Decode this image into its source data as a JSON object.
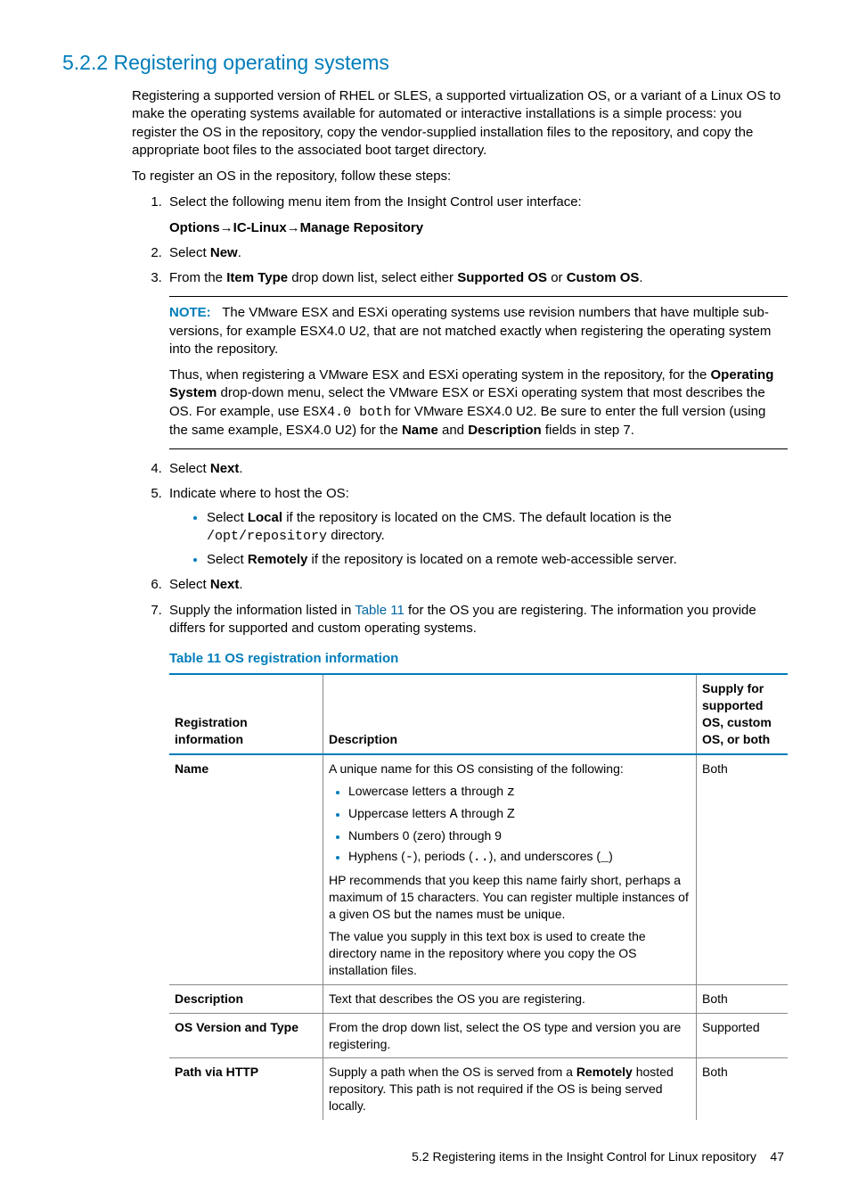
{
  "heading": "5.2.2 Registering operating systems",
  "intro_p1": "Registering a supported version of RHEL or SLES, a supported virtualization OS, or a variant of a Linux OS to make the operating systems available for automated or interactive installations is a simple process: you register the OS in the repository, copy the vendor-supplied installation files to the repository, and copy the appropriate boot files to the associated boot target directory.",
  "intro_p2": "To register an OS in the repository, follow these steps:",
  "step1_text": "Select the following menu item from the Insight Control user interface:",
  "menu_path_options": "Options",
  "menu_path_ic": "IC-Linux",
  "menu_path_manage": "Manage Repository",
  "step2_pre": "Select ",
  "step2_b": "New",
  "step2_post": ".",
  "step3_pre": "From the ",
  "step3_b1": "Item Type",
  "step3_mid": " drop down list, select either ",
  "step3_b2": "Supported OS",
  "step3_or": " or ",
  "step3_b3": "Custom OS",
  "step3_post": ".",
  "note_label": "NOTE:",
  "note_p1": "The VMware ESX and ESXi operating systems use revision numbers that have multiple sub-versions, for example ESX4.0 U2, that are not matched exactly when registering the operating system into the repository.",
  "note_p2_a": "Thus, when registering a VMware ESX and ESXi operating system in the repository, for the ",
  "note_p2_b1": "Operating System",
  "note_p2_b": " drop-down menu, select the VMware ESX or ESXi operating system that most describes the OS. For example, use ",
  "note_code": "ESX4.0 both",
  "note_p2_c": " for VMware ESX4.0 U2. Be sure to enter the full version (using the same example, ESX4.0 U2) for the ",
  "note_p2_b2": "Name",
  "note_p2_and": " and ",
  "note_p2_b3": "Description",
  "note_p2_d": " fields in step 7.",
  "step4_pre": "Select ",
  "step4_b": "Next",
  "step4_post": ".",
  "step5_text": "Indicate where to host the OS:",
  "step5_bullet1_pre": "Select ",
  "step5_bullet1_b": "Local",
  "step5_bullet1_mid": " if the repository is located on the CMS. The default location is the ",
  "step5_bullet1_code": "/opt/repository",
  "step5_bullet1_post": " directory.",
  "step5_bullet2_pre": "Select ",
  "step5_bullet2_b": "Remotely",
  "step5_bullet2_post": " if the repository is located on a remote web-accessible server.",
  "step6_pre": "Select ",
  "step6_b": "Next",
  "step6_post": ".",
  "step7_pre": "Supply the information listed in ",
  "step7_link": "Table 11",
  "step7_post": " for the OS you are registering. The information you provide differs for supported and custom operating systems.",
  "table_caption": "Table 11 OS registration information",
  "th1": "Registration information",
  "th2": "Description",
  "th3": "Supply for supported OS, custom OS, or both",
  "chart_data": {
    "type": "table",
    "columns": [
      "Registration information",
      "Description",
      "Supply for supported OS, custom OS, or both"
    ],
    "rows": [
      {
        "name": "Name",
        "desc_intro": "A unique name for this OS consisting of the following:",
        "bullets": [
          {
            "pre": "Lowercase letters ",
            "code1": "a",
            "mid": " through ",
            "code2": "z",
            "post": ""
          },
          {
            "pre": "Uppercase letters ",
            "code1": "A",
            "mid": " through ",
            "code2": "Z",
            "post": ""
          },
          {
            "pre": "Numbers 0 (zero) through 9",
            "code1": "",
            "mid": "",
            "code2": "",
            "post": ""
          },
          {
            "pre": "Hyphens (",
            "code1": "-",
            "mid": "), periods (",
            "code2": "..",
            "post": "), and underscores (",
            "code3": "_",
            "post2": ")"
          }
        ],
        "desc_p2": "HP recommends that you keep this name fairly short, perhaps a maximum of 15 characters. You can register multiple instances of a given OS but the names must be unique.",
        "desc_p3": "The value you supply in this text box is used to create the directory name in the repository where you copy the OS installation files.",
        "supply": "Both"
      },
      {
        "name": "Description",
        "desc": "Text that describes the OS you are registering.",
        "supply": "Both"
      },
      {
        "name": "OS Version and Type",
        "desc": "From the drop down list, select the OS type and version you are registering.",
        "supply": "Supported"
      },
      {
        "name": "Path via HTTP",
        "desc_pre": "Supply a path when the OS is served from a ",
        "desc_b": "Remotely",
        "desc_post": " hosted repository. This path is not required if the OS is being served locally.",
        "supply": "Both"
      }
    ]
  },
  "footer_text": "5.2 Registering items in the Insight Control for Linux repository",
  "footer_page": "47"
}
